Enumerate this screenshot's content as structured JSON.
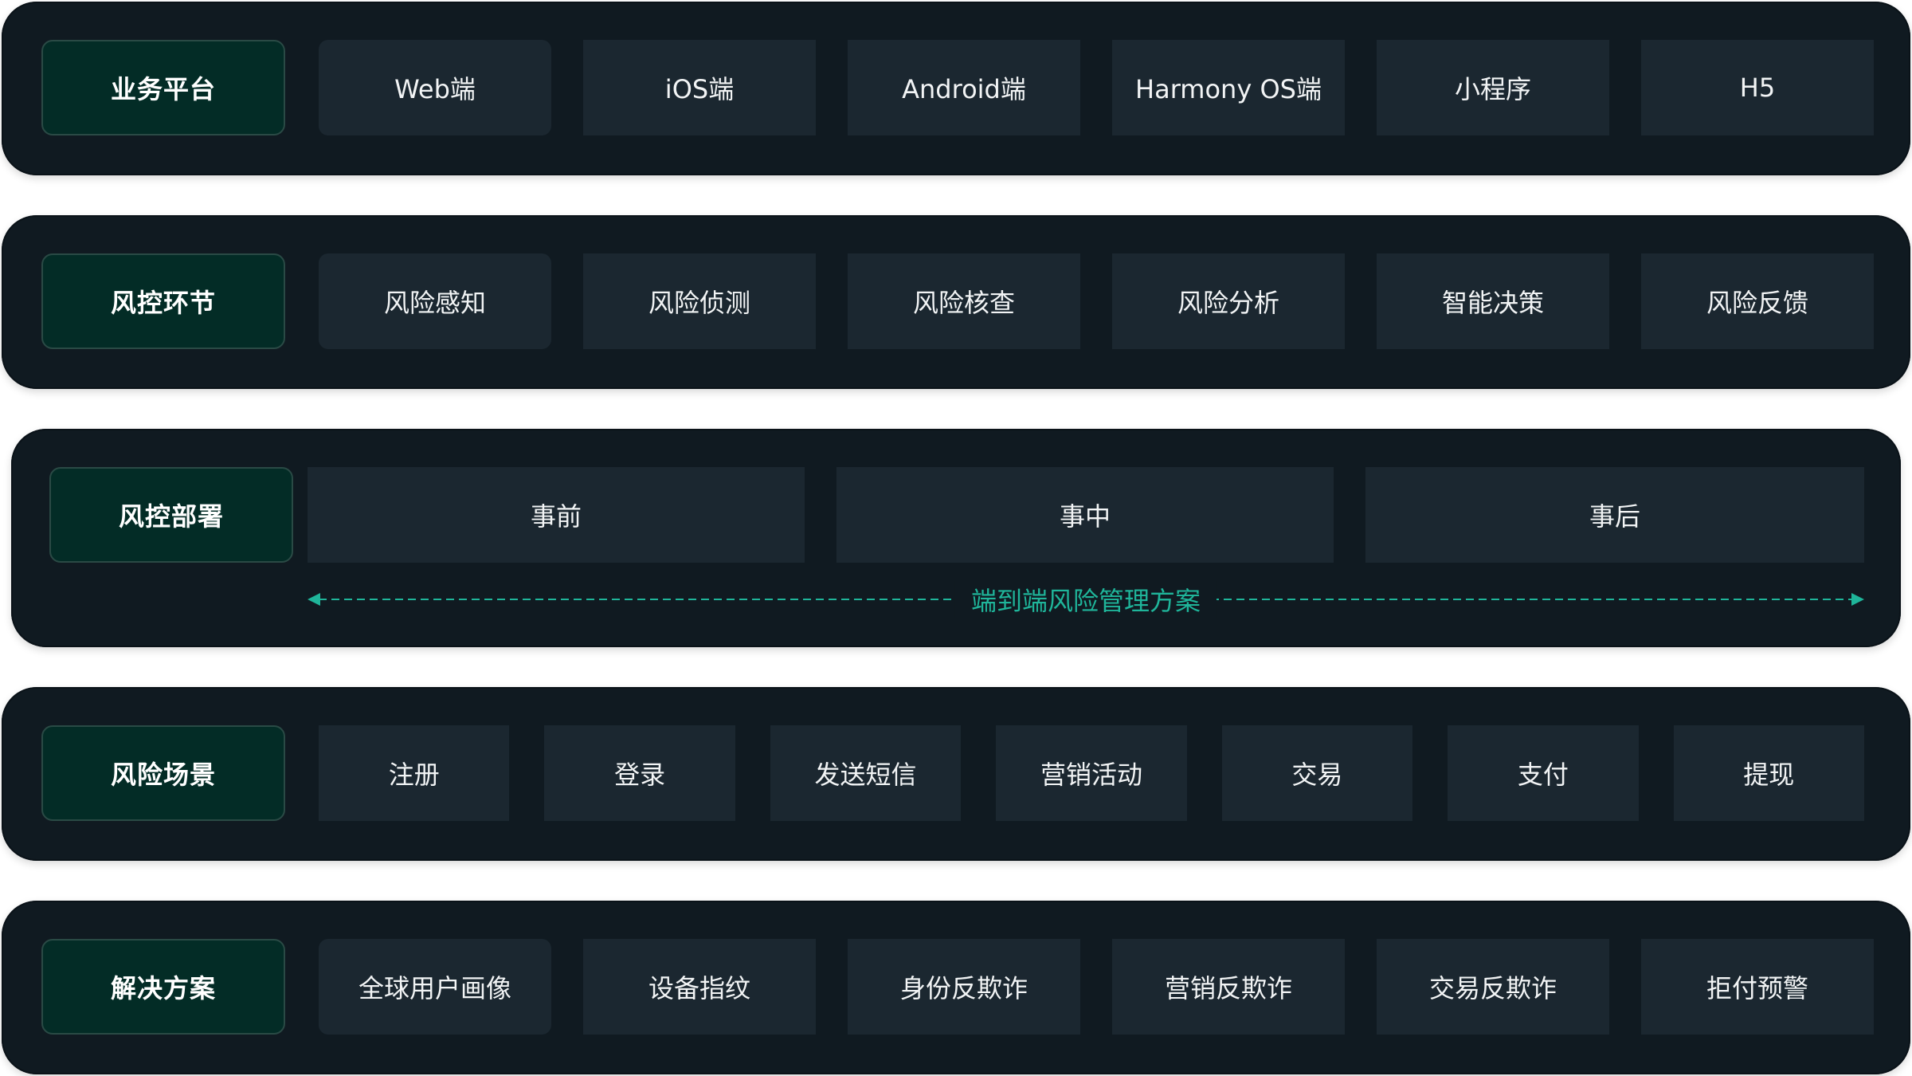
{
  "rows": [
    {
      "label": "业务平台",
      "items": [
        "Web端",
        "iOS端",
        "Android端",
        "Harmony OS端",
        "小程序",
        "H5"
      ]
    },
    {
      "label": "风控环节",
      "items": [
        "风险感知",
        "风险侦测",
        "风险核查",
        "风险分析",
        "智能决策",
        "风险反馈"
      ]
    },
    {
      "label": "风控部署",
      "items": [
        "事前",
        "事中",
        "事后"
      ],
      "flow_label": "端到端风险管理方案"
    },
    {
      "label": "风险场景",
      "items": [
        "注册",
        "登录",
        "发送短信",
        "营销活动",
        "交易",
        "支付",
        "提现"
      ]
    },
    {
      "label": "解决方案",
      "items": [
        "全球用户画像",
        "设备指纹",
        "身份反欺诈",
        "营销反欺诈",
        "交易反欺诈",
        "拒付预警"
      ]
    }
  ],
  "colors": {
    "row_bg": "#101a21",
    "label_bg": "#032c26",
    "item_bg": "#1b2730",
    "accent": "#1fb59a"
  }
}
